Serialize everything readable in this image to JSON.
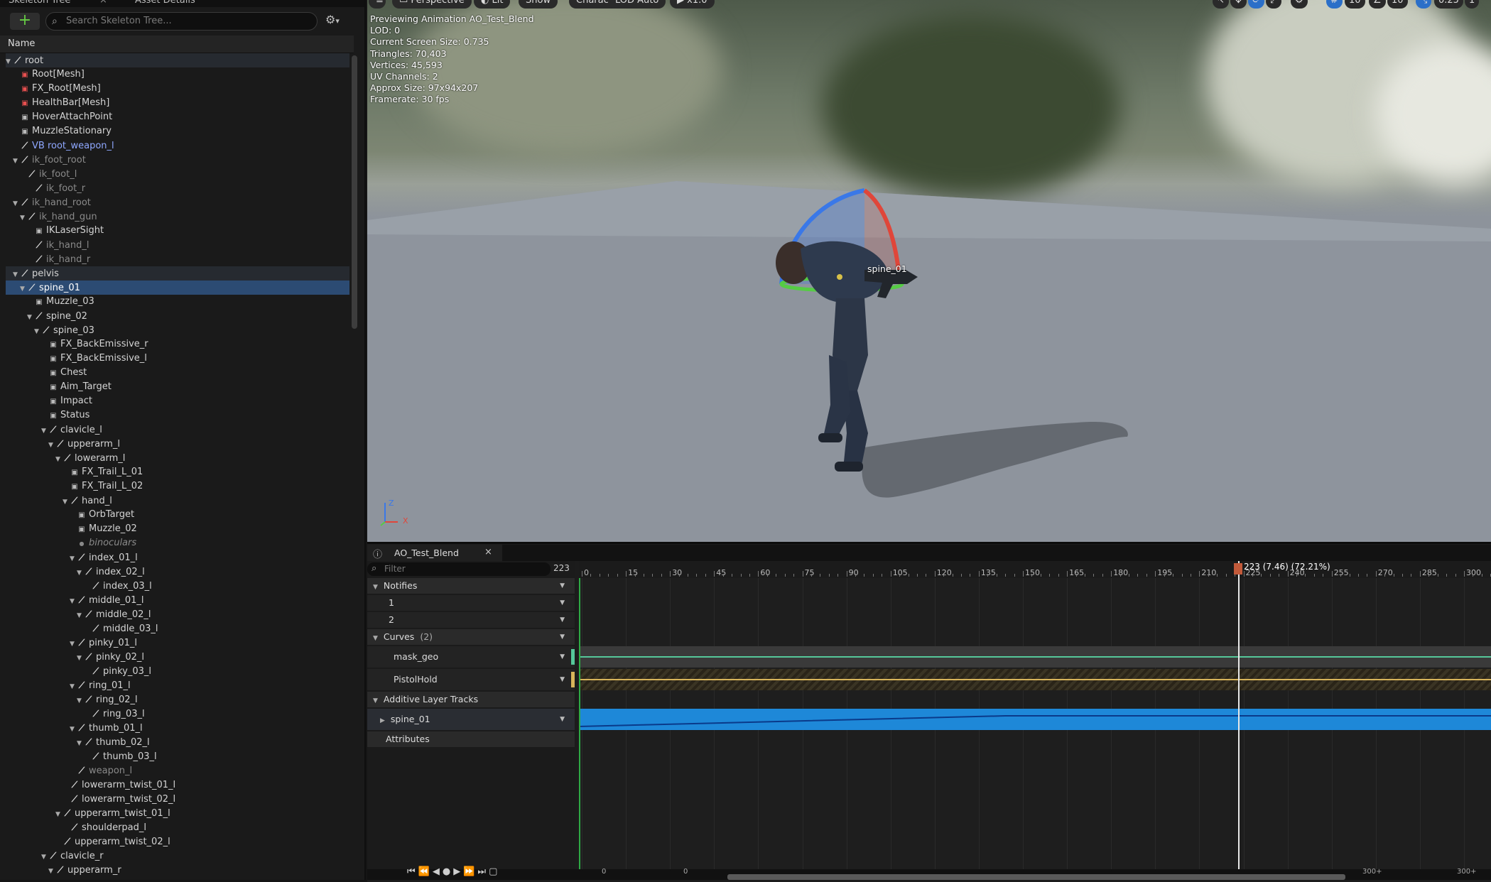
{
  "tabs": {
    "skeleton_tree": "Skeleton Tree",
    "asset_details": "Asset Details"
  },
  "search": {
    "placeholder": "Search Skeleton Tree..."
  },
  "column_header": "Name",
  "tree": [
    {
      "label": "root",
      "icon": "bone-icon",
      "depth": 0,
      "arrow": "open",
      "style": "hl"
    },
    {
      "label": "Root",
      "suffix": "[Mesh]",
      "icon": "mesh-socket-icon",
      "depth": 1,
      "arrow": "",
      "style": ""
    },
    {
      "label": "FX_Root",
      "suffix": "[Mesh]",
      "icon": "mesh-socket-icon",
      "depth": 1,
      "arrow": "",
      "style": ""
    },
    {
      "label": "HealthBar",
      "suffix": "[Mesh]",
      "icon": "mesh-socket-icon",
      "depth": 1,
      "arrow": "",
      "style": ""
    },
    {
      "label": "HoverAttachPoint",
      "icon": "socket-icon",
      "depth": 1,
      "arrow": "",
      "style": ""
    },
    {
      "label": "MuzzleStationary",
      "icon": "socket-icon",
      "depth": 1,
      "arrow": "",
      "style": ""
    },
    {
      "label": "VB root_weapon_l",
      "icon": "bone-icon",
      "depth": 1,
      "arrow": "",
      "style": "virt"
    },
    {
      "label": "ik_foot_root",
      "icon": "bone-icon",
      "depth": 1,
      "arrow": "open",
      "style": "dim"
    },
    {
      "label": "ik_foot_l",
      "icon": "bone-icon",
      "depth": 2,
      "arrow": "",
      "style": "dim"
    },
    {
      "label": "ik_foot_r",
      "icon": "bone-icon",
      "depth": 3,
      "arrow": "",
      "style": "dim"
    },
    {
      "label": "ik_hand_root",
      "icon": "bone-icon",
      "depth": 1,
      "arrow": "open",
      "style": "dim"
    },
    {
      "label": "ik_hand_gun",
      "icon": "bone-icon",
      "depth": 2,
      "arrow": "open",
      "style": "dim"
    },
    {
      "label": "IKLaserSight",
      "icon": "socket-icon",
      "depth": 3,
      "arrow": "",
      "style": ""
    },
    {
      "label": "ik_hand_l",
      "icon": "bone-icon",
      "depth": 3,
      "arrow": "",
      "style": "dim"
    },
    {
      "label": "ik_hand_r",
      "icon": "bone-icon",
      "depth": 3,
      "arrow": "",
      "style": "dim"
    },
    {
      "label": "pelvis",
      "icon": "bone-icon",
      "depth": 1,
      "arrow": "open",
      "style": "hl"
    },
    {
      "label": "spine_01",
      "icon": "bone-icon",
      "depth": 2,
      "arrow": "open",
      "style": "sel"
    },
    {
      "label": "Muzzle_03",
      "icon": "socket-icon",
      "depth": 3,
      "arrow": "",
      "style": ""
    },
    {
      "label": "spine_02",
      "icon": "bone-icon",
      "depth": 3,
      "arrow": "open",
      "style": ""
    },
    {
      "label": "spine_03",
      "icon": "bone-icon",
      "depth": 4,
      "arrow": "open",
      "style": ""
    },
    {
      "label": "FX_BackEmissive_r",
      "icon": "socket-icon",
      "depth": 5,
      "arrow": "",
      "style": ""
    },
    {
      "label": "FX_BackEmissive_l",
      "icon": "socket-icon",
      "depth": 5,
      "arrow": "",
      "style": ""
    },
    {
      "label": "Chest",
      "icon": "socket-icon",
      "depth": 5,
      "arrow": "",
      "style": ""
    },
    {
      "label": "Aim_Target",
      "icon": "socket-icon",
      "depth": 5,
      "arrow": "",
      "style": ""
    },
    {
      "label": "Impact",
      "icon": "socket-icon",
      "depth": 5,
      "arrow": "",
      "style": ""
    },
    {
      "label": "Status",
      "icon": "socket-icon",
      "depth": 5,
      "arrow": "",
      "style": ""
    },
    {
      "label": "clavicle_l",
      "icon": "bone-icon",
      "depth": 5,
      "arrow": "open",
      "style": ""
    },
    {
      "label": "upperarm_l",
      "icon": "bone-icon",
      "depth": 6,
      "arrow": "open",
      "style": ""
    },
    {
      "label": "lowerarm_l",
      "icon": "bone-icon",
      "depth": 7,
      "arrow": "open",
      "style": ""
    },
    {
      "label": "FX_Trail_L_01",
      "icon": "socket-icon",
      "depth": 8,
      "arrow": "",
      "style": ""
    },
    {
      "label": "FX_Trail_L_02",
      "icon": "socket-icon",
      "depth": 8,
      "arrow": "",
      "style": ""
    },
    {
      "label": "hand_l",
      "icon": "bone-icon",
      "depth": 8,
      "arrow": "open",
      "style": ""
    },
    {
      "label": "OrbTarget",
      "icon": "socket-icon",
      "depth": 9,
      "arrow": "",
      "style": ""
    },
    {
      "label": "Muzzle_02",
      "icon": "socket-icon",
      "depth": 9,
      "arrow": "",
      "style": ""
    },
    {
      "label": "binoculars",
      "icon": "dot-icon",
      "depth": 9,
      "arrow": "",
      "style": "ital"
    },
    {
      "label": "index_01_l",
      "icon": "bone-icon",
      "depth": 9,
      "arrow": "open",
      "style": ""
    },
    {
      "label": "index_02_l",
      "icon": "bone-icon",
      "depth": 10,
      "arrow": "open",
      "style": ""
    },
    {
      "label": "index_03_l",
      "icon": "bone-icon",
      "depth": 11,
      "arrow": "",
      "style": ""
    },
    {
      "label": "middle_01_l",
      "icon": "bone-icon",
      "depth": 9,
      "arrow": "open",
      "style": ""
    },
    {
      "label": "middle_02_l",
      "icon": "bone-icon",
      "depth": 10,
      "arrow": "open",
      "style": ""
    },
    {
      "label": "middle_03_l",
      "icon": "bone-icon",
      "depth": 11,
      "arrow": "",
      "style": ""
    },
    {
      "label": "pinky_01_l",
      "icon": "bone-icon",
      "depth": 9,
      "arrow": "open",
      "style": ""
    },
    {
      "label": "pinky_02_l",
      "icon": "bone-icon",
      "depth": 10,
      "arrow": "open",
      "style": ""
    },
    {
      "label": "pinky_03_l",
      "icon": "bone-icon",
      "depth": 11,
      "arrow": "",
      "style": ""
    },
    {
      "label": "ring_01_l",
      "icon": "bone-icon",
      "depth": 9,
      "arrow": "open",
      "style": ""
    },
    {
      "label": "ring_02_l",
      "icon": "bone-icon",
      "depth": 10,
      "arrow": "open",
      "style": ""
    },
    {
      "label": "ring_03_l",
      "icon": "bone-icon",
      "depth": 11,
      "arrow": "",
      "style": ""
    },
    {
      "label": "thumb_01_l",
      "icon": "bone-icon",
      "depth": 9,
      "arrow": "open",
      "style": ""
    },
    {
      "label": "thumb_02_l",
      "icon": "bone-icon",
      "depth": 10,
      "arrow": "open",
      "style": ""
    },
    {
      "label": "thumb_03_l",
      "icon": "bone-icon",
      "depth": 11,
      "arrow": "",
      "style": ""
    },
    {
      "label": "weapon_l",
      "icon": "bone-icon",
      "depth": 9,
      "arrow": "",
      "style": "dim"
    },
    {
      "label": "lowerarm_twist_01_l",
      "icon": "bone-icon",
      "depth": 8,
      "arrow": "",
      "style": ""
    },
    {
      "label": "lowerarm_twist_02_l",
      "icon": "bone-icon",
      "depth": 8,
      "arrow": "",
      "style": ""
    },
    {
      "label": "upperarm_twist_01_l",
      "icon": "bone-icon",
      "depth": 7,
      "arrow": "open",
      "style": ""
    },
    {
      "label": "shoulderpad_l",
      "icon": "bone-icon",
      "depth": 8,
      "arrow": "",
      "style": ""
    },
    {
      "label": "upperarm_twist_02_l",
      "icon": "bone-icon",
      "depth": 7,
      "arrow": "",
      "style": ""
    },
    {
      "label": "clavicle_r",
      "icon": "bone-icon",
      "depth": 5,
      "arrow": "open",
      "style": ""
    },
    {
      "label": "upperarm_r",
      "icon": "bone-icon",
      "depth": 6,
      "arrow": "open",
      "style": ""
    }
  ],
  "viewport": {
    "buttons": [
      "Perspective",
      "Lit",
      "Show",
      "Character",
      "LOD Auto",
      "x1.0"
    ],
    "right_values": [
      "10",
      "10",
      "0.25",
      "1"
    ],
    "stats": [
      "Previewing Animation AO_Test_Blend",
      "LOD: 0",
      "Current Screen Size: 0.735",
      "Triangles: 70,403",
      "Vertices: 45,593",
      "UV Channels: 2",
      "Approx Size: 97x94x207",
      "Framerate: 30 fps"
    ],
    "bone_label": "spine_01",
    "axis": {
      "z": "Z",
      "x": "X"
    }
  },
  "timeline": {
    "tab_label": "AO_Test_Blend",
    "filter_placeholder": "Filter",
    "frame_counter": "223",
    "playhead_label": "223 (7.46) (72.21%)",
    "ruler": [
      "0",
      "15",
      "30",
      "45",
      "60",
      "75",
      "90",
      "105",
      "120",
      "135",
      "150",
      "165",
      "180",
      "195",
      "210",
      "225",
      "240",
      "255",
      "270",
      "285",
      "300"
    ],
    "notifies_label": "Notifies",
    "notify_tracks": [
      "1",
      "2"
    ],
    "curves_label": "Curves",
    "curves_count": "(2)",
    "curves": [
      "mask_geo",
      "PistolHold"
    ],
    "additive_label": "Additive Layer Tracks",
    "additive_tracks": [
      "spine_01"
    ],
    "attributes_label": "Attributes",
    "bottom_numbers": [
      "0",
      "0",
      "0",
      "300+",
      "300+"
    ]
  },
  "colors": {
    "accent": "#2c4b73",
    "playhead": "#c25a3a",
    "additive": "#1e88d8",
    "curve_green": "#55c79a",
    "curve_yellow": "#d8b45a"
  }
}
